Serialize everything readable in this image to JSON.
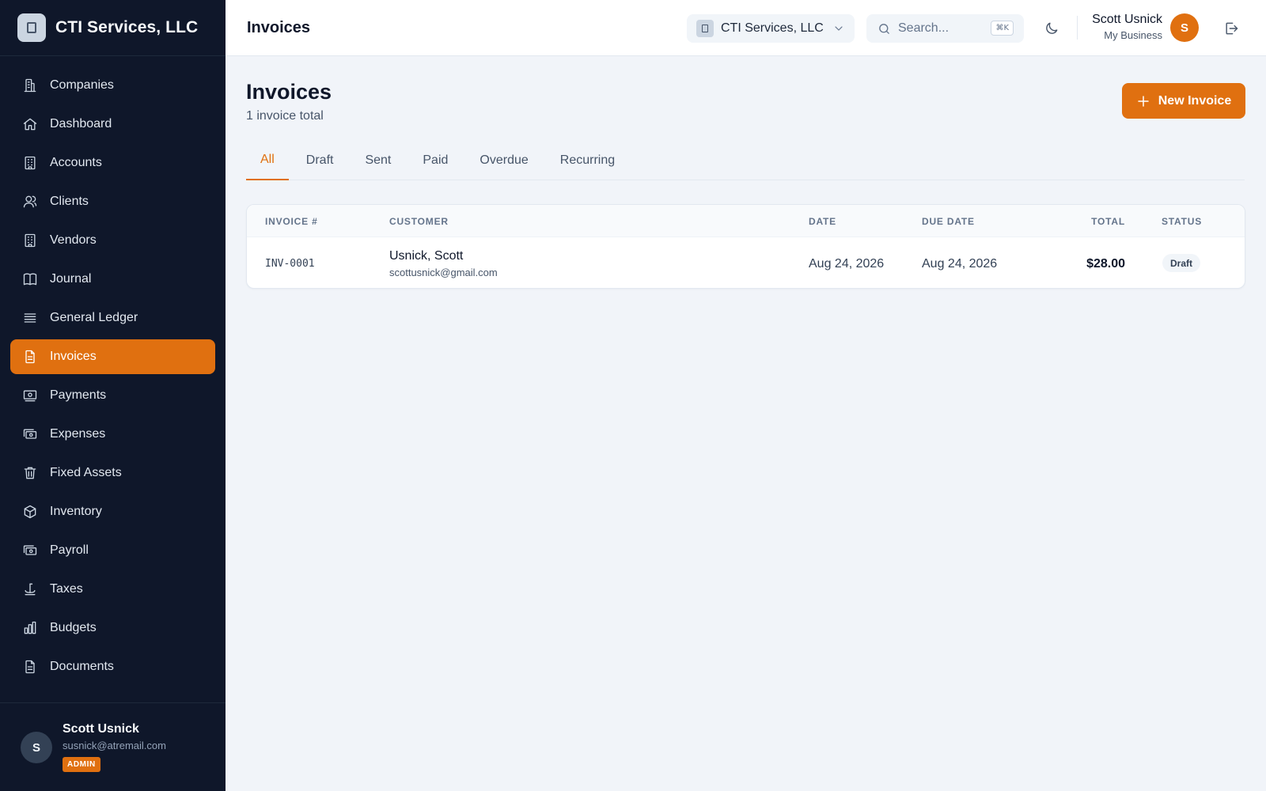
{
  "brand": {
    "name": "CTI Services, LLC"
  },
  "sidebar": {
    "items": [
      {
        "label": "Companies",
        "icon": "companies-icon",
        "active": false
      },
      {
        "label": "Dashboard",
        "icon": "home-icon",
        "active": false
      },
      {
        "label": "Accounts",
        "icon": "building-icon",
        "active": false
      },
      {
        "label": "Clients",
        "icon": "users-icon",
        "active": false
      },
      {
        "label": "Vendors",
        "icon": "building-icon",
        "active": false
      },
      {
        "label": "Journal",
        "icon": "book-icon",
        "active": false
      },
      {
        "label": "General Ledger",
        "icon": "list-icon",
        "active": false
      },
      {
        "label": "Invoices",
        "icon": "document-icon",
        "active": true
      },
      {
        "label": "Payments",
        "icon": "banknote-icon",
        "active": false
      },
      {
        "label": "Expenses",
        "icon": "cash-icon",
        "active": false
      },
      {
        "label": "Fixed Assets",
        "icon": "trash-icon",
        "active": false
      },
      {
        "label": "Inventory",
        "icon": "cube-icon",
        "active": false
      },
      {
        "label": "Payroll",
        "icon": "cash-icon",
        "active": false
      },
      {
        "label": "Taxes",
        "icon": "scale-icon",
        "active": false
      },
      {
        "label": "Budgets",
        "icon": "bar-chart-icon",
        "active": false
      },
      {
        "label": "Documents",
        "icon": "document-icon",
        "active": false
      }
    ],
    "user": {
      "initial": "S",
      "name": "Scott Usnick",
      "email": "susnick@atremail.com",
      "role": "ADMIN"
    }
  },
  "topbar": {
    "title": "Invoices",
    "company_selector": "CTI Services, LLC",
    "search_placeholder": "Search...",
    "search_shortcut": "⌘K",
    "user_name": "Scott Usnick",
    "user_subtitle": "My Business",
    "user_initial": "S"
  },
  "page": {
    "title": "Invoices",
    "subtitle": "1 invoice total",
    "new_button": "New Invoice",
    "tabs": [
      {
        "label": "All",
        "active": true
      },
      {
        "label": "Draft",
        "active": false
      },
      {
        "label": "Sent",
        "active": false
      },
      {
        "label": "Paid",
        "active": false
      },
      {
        "label": "Overdue",
        "active": false
      },
      {
        "label": "Recurring",
        "active": false
      }
    ]
  },
  "table": {
    "columns": [
      "INVOICE #",
      "CUSTOMER",
      "DATE",
      "DUE DATE",
      "TOTAL",
      "STATUS"
    ],
    "rows": [
      {
        "invoice": "INV-0001",
        "customer_name": "Usnick, Scott",
        "customer_email": "scottusnick@gmail.com",
        "date": "Aug 24, 2026",
        "due_date": "Aug 24, 2026",
        "total": "$28.00",
        "status": "Draft"
      }
    ]
  },
  "colors": {
    "accent": "#e07010",
    "sidebar_bg": "#0f172a",
    "page_bg": "#f1f4f9"
  }
}
